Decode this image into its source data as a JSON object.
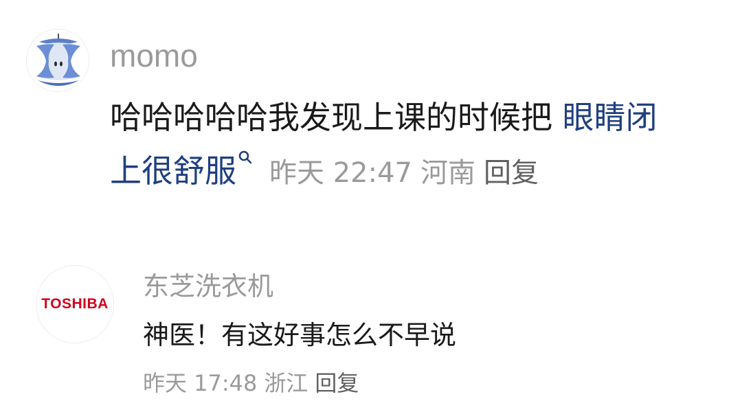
{
  "comments": [
    {
      "username": "momo",
      "text": "哈哈哈哈哈我发现上课的时候把",
      "keyword_line1": "眼睛闭",
      "keyword_line2": "上很舒服",
      "time": "昨天 22:47",
      "location": "河南",
      "reply_label": "回复",
      "avatar_icon": "apple-core-icon"
    },
    {
      "username": "东芝洗衣机",
      "avatar_logo_text": "TOSHIBA",
      "text": "神医！有这好事怎么不早说",
      "time": "昨天 17:48",
      "location": "浙江",
      "reply_label": "回复"
    }
  ],
  "colors": {
    "keyword_link": "#1f3f80",
    "meta_gray": "#9a9a9a",
    "toshiba_red": "#d0021b"
  }
}
